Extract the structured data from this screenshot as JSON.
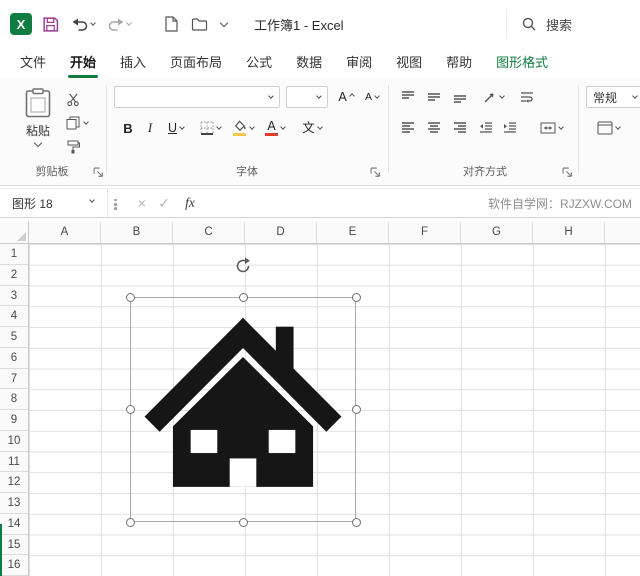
{
  "titlebar": {
    "app_title": "工作簿1 - Excel",
    "search_label": "搜索"
  },
  "tabs": {
    "items": [
      {
        "label": "文件"
      },
      {
        "label": "开始",
        "active": true
      },
      {
        "label": "插入"
      },
      {
        "label": "页面布局"
      },
      {
        "label": "公式"
      },
      {
        "label": "数据"
      },
      {
        "label": "审阅"
      },
      {
        "label": "视图"
      },
      {
        "label": "帮助"
      },
      {
        "label": "图形格式",
        "contextual": true
      }
    ]
  },
  "ribbon": {
    "clipboard": {
      "paste_label": "粘贴",
      "group_label": "剪贴板"
    },
    "font": {
      "group_label": "字体",
      "bold_label": "B",
      "italic_label": "I",
      "underline_label": "U",
      "grow_label": "A",
      "shrink_label": "A",
      "color_label": "A",
      "phonetic_label": "文",
      "font_name_value": "",
      "font_size_value": ""
    },
    "alignment": {
      "group_label": "对齐方式"
    },
    "number": {
      "format_value": "常规"
    }
  },
  "formula_bar": {
    "name_box_value": "图形 18",
    "cancel_label": "×",
    "enter_label": "✓",
    "fx_label": "fx",
    "formula_value": "",
    "watermark": "软件自学网：RJZXW.COM"
  },
  "grid": {
    "columns": [
      "A",
      "B",
      "C",
      "D",
      "E",
      "F",
      "G",
      "H"
    ],
    "rows": [
      "1",
      "2",
      "3",
      "4",
      "5",
      "6",
      "7",
      "8",
      "9",
      "10",
      "11",
      "12",
      "13",
      "14",
      "15",
      "16"
    ]
  },
  "shape": {
    "kind": "house",
    "selected": true,
    "fill": "#161616",
    "spans": "B3:E13",
    "name_box_reference": "图形 18"
  },
  "colors": {
    "excel_green": "#107C41",
    "save_icon": "#9C3D96",
    "font_color_bar": "#E03E2D",
    "fill_color_bar": "#F2C94C"
  }
}
